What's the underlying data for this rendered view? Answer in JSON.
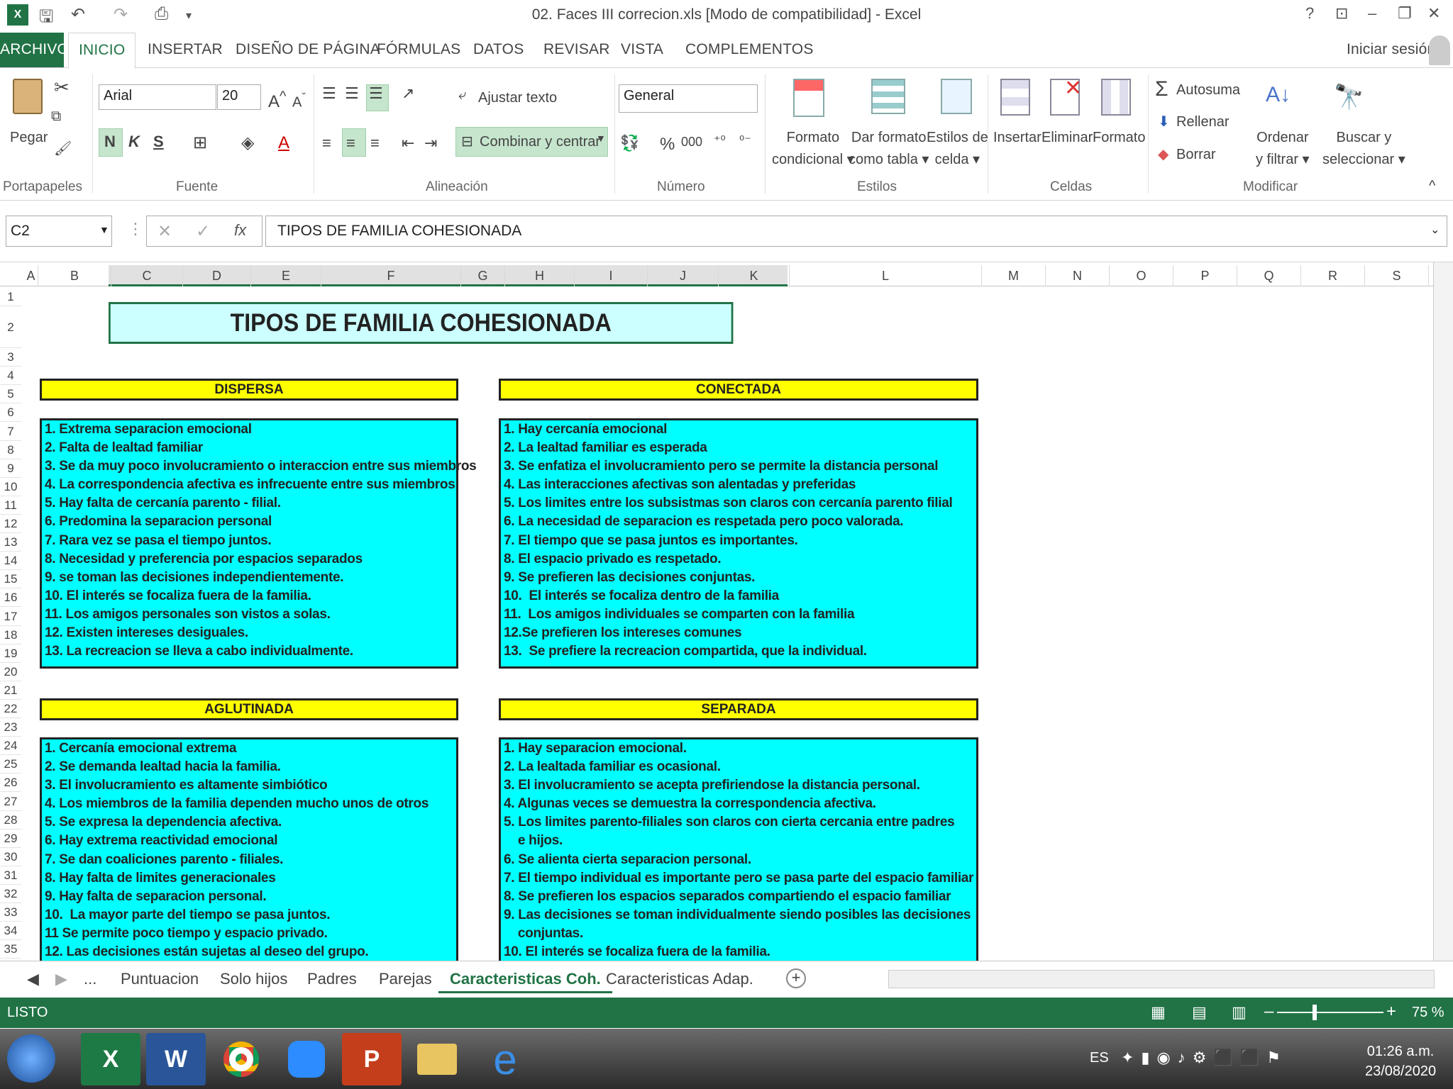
{
  "window": {
    "title": "02. Faces III correcion.xls  [Modo de compatibilidad] - Excel"
  },
  "tabs": [
    "ARCHIVO",
    "INICIO",
    "INSERTAR",
    "DISEÑO DE PÁGINA",
    "FÓRMULAS",
    "DATOS",
    "REVISAR",
    "VISTA",
    "COMPLEMENTOS"
  ],
  "account": {
    "signin": "Iniciar sesión"
  },
  "ribbon": {
    "clipboard": {
      "paste": "Pegar",
      "group": "Portapapeles"
    },
    "font": {
      "name": "Arial",
      "size": "20",
      "bold": "N",
      "italic": "K",
      "underline": "S",
      "group": "Fuente"
    },
    "align": {
      "wrap": "Ajustar texto",
      "merge": "Combinar y centrar",
      "group": "Alineación"
    },
    "number": {
      "format": "General",
      "percent": "%",
      "thousands": "000",
      "group": "Número"
    },
    "styles": {
      "cond1": "Formato",
      "cond2": "condicional",
      "table1": "Dar formato",
      "table2": "como tabla",
      "cell1": "Estilos de",
      "cell2": "celda",
      "group": "Estilos"
    },
    "cells": {
      "insert": "Insertar",
      "delete": "Eliminar",
      "format": "Formato",
      "group": "Celdas"
    },
    "edit": {
      "autosum": "Autosuma",
      "fill": "Rellenar",
      "clear": "Borrar",
      "sort1": "Ordenar",
      "sort2": "y filtrar",
      "find1": "Buscar y",
      "find2": "seleccionar",
      "group": "Modificar"
    }
  },
  "formula_bar": {
    "name_box": "C2",
    "fx": "fx",
    "content": "TIPOS DE FAMILIA COHESIONADA"
  },
  "columns": [
    "A",
    "B",
    "C",
    "D",
    "E",
    "F",
    "G",
    "H",
    "I",
    "J",
    "K",
    "L",
    "M",
    "N",
    "O",
    "P",
    "Q",
    "R",
    "S"
  ],
  "rows": [
    "1",
    "2",
    "3",
    "4",
    "5",
    "6",
    "7",
    "8",
    "9",
    "10",
    "11",
    "12",
    "13",
    "14",
    "15",
    "16",
    "17",
    "18",
    "19",
    "20",
    "21",
    "22",
    "23",
    "24",
    "25",
    "26",
    "27",
    "28",
    "29",
    "30",
    "31",
    "32",
    "33",
    "34",
    "35"
  ],
  "sheet": {
    "title": "TIPOS DE FAMILIA COHESIONADA",
    "dispersa": {
      "header": "DISPERSA",
      "items": [
        "1. Extrema separacion emocional",
        "2. Falta de lealtad familiar",
        "3. Se da muy poco involucramiento o interaccion entre sus miembros",
        "4. La correspondencia afectiva es infrecuente entre sus miembros",
        "5. Hay falta de cercanía parento - filial.",
        "6. Predomina la separacion personal",
        "7. Rara vez se pasa el tiempo juntos.",
        "8. Necesidad y preferencia por espacios separados",
        "9. se toman las decisiones independientemente.",
        "10. El interés se focaliza fuera de la familia.",
        "11. Los amigos personales son vistos a solas.",
        "12. Existen intereses desiguales.",
        "13. La recreacion se lleva a cabo individualmente."
      ]
    },
    "conectada": {
      "header": "CONECTADA",
      "items": [
        "1. Hay cercanía emocional",
        "2. La lealtad familiar es esperada",
        "3. Se enfatiza el involucramiento pero se permite la distancia personal",
        "4. Las interacciones afectivas son alentadas y preferidas",
        "5. Los limites entre los subsistmas son claros con cercanía parento filial",
        "6. La necesidad de separacion es respetada pero poco valorada.",
        "7. El tiempo que se pasa juntos es importantes.",
        "8. El espacio privado es respetado.",
        "9. Se prefieren las decisiones conjuntas.",
        "10.  El interés se focaliza dentro de la familia",
        "11.  Los amigos individuales se comparten con la familia",
        "12.Se prefieren los intereses comunes",
        "13.  Se prefiere la recreacion compartida, que la individual."
      ]
    },
    "aglutinada": {
      "header": "AGLUTINADA",
      "items": [
        "1. Cercanía emocional extrema",
        "2. Se demanda lealtad hacia la familia.",
        "3. El involucramiento es altamente simbiótico",
        "4. Los miembros de la familia dependen mucho unos de otros",
        "5. Se expresa la dependencia afectiva.",
        "6. Hay extrema reactividad emocional",
        "7. Se dan coaliciones parento - filiales.",
        "8. Hay falta de limites generacionales",
        "9. Hay falta de separacion personal.",
        "10.  La mayor parte del tiempo se pasa juntos.",
        "11 Se permite poco tiempo y espacio privado.",
        "12. Las decisiones están sujetas al deseo del grupo."
      ]
    },
    "separada": {
      "header": "SEPARADA",
      "items": [
        "1. Hay separacion emocional.",
        "2. La lealtada familiar es ocasional.",
        "3. El involucramiento se acepta prefiriendose la distancia personal.",
        "4. Algunas veces se demuestra la correspondencia afectiva.",
        "5. Los limites parento-filiales son claros con cierta cercania entre padres",
        "    e hijos.",
        "6. Se alienta cierta separacion personal.",
        "7. El tiempo individual es importante pero se pasa parte del espacio familiar",
        "8. Se prefieren los espacios separados compartiendo el espacio familiar",
        "9. Las decisiones se toman individualmente siendo posibles las decisiones",
        "    conjuntas.",
        "10. El interés se focaliza fuera de la familia."
      ]
    }
  },
  "sheet_tabs": [
    "...",
    "Puntuacion",
    "Solo hijos",
    "Padres",
    "Parejas",
    "Caracteristicas Coh.",
    "Caracteristicas Adap."
  ],
  "status": {
    "mode": "LISTO",
    "zoom": "75 %"
  },
  "taskbar": {
    "lang": "ES",
    "time": "01:26 a.m.",
    "date": "23/08/2020"
  },
  "colors": {
    "excel_green": "#217346",
    "title_fill": "#ccffff",
    "header_fill": "#ffff00",
    "box_fill": "#00ffff"
  }
}
